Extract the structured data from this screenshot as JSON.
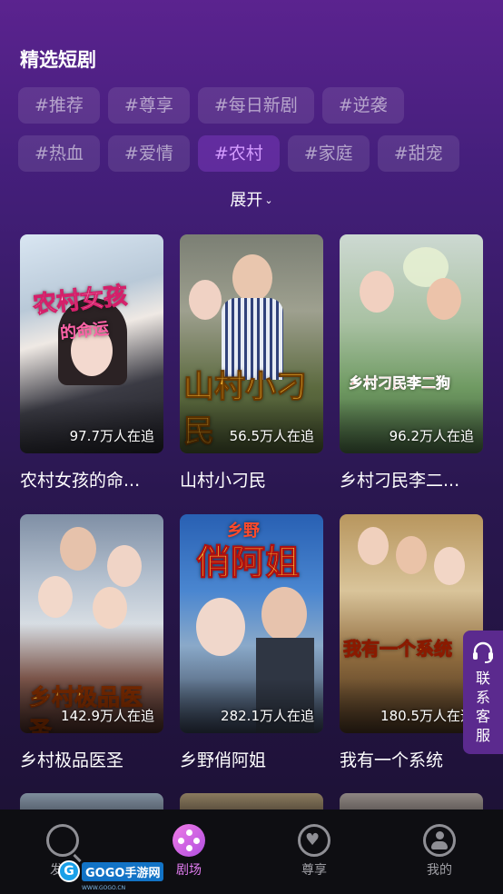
{
  "section_title": "精选短剧",
  "tags": [
    [
      "#推荐",
      "#尊享",
      "#每日新剧",
      "#逆袭"
    ],
    [
      "#热血",
      "#爱情",
      "#农村",
      "#家庭",
      "#甜宠"
    ]
  ],
  "active_tag": "#农村",
  "expand_label": "展开",
  "dramas": [
    {
      "title": "农村女孩的命...",
      "followers": "97.7万人在追",
      "poster_text": "农村女孩的命运"
    },
    {
      "title": "山村小刁民",
      "followers": "56.5万人在追",
      "poster_text": "山村小刁民"
    },
    {
      "title": "乡村刁民李二...",
      "followers": "96.2万人在追",
      "poster_text": "乡村刁民李二狗"
    },
    {
      "title": "乡村极品医圣",
      "followers": "142.9万人在追",
      "poster_text": "乡村极品医圣"
    },
    {
      "title": "乡野俏阿姐",
      "followers": "282.1万人在追",
      "poster_text": "乡野俏阿姐"
    },
    {
      "title": "我有一个系统",
      "followers": "180.5万人在追",
      "poster_text": "我有一个系统"
    }
  ],
  "side_tab": {
    "label": "联系客服",
    "icon": "headset-icon"
  },
  "tabbar": [
    {
      "label": "发现",
      "icon": "search-icon"
    },
    {
      "label": "剧场",
      "icon": "film-reel-icon",
      "active": true
    },
    {
      "label": "尊享",
      "icon": "heart-icon"
    },
    {
      "label": "我的",
      "icon": "user-icon"
    }
  ],
  "watermark": {
    "text": "GOGO手游网",
    "sub": "WWW.GOGO.CN"
  },
  "colors": {
    "accent": "#e27cf0",
    "background_top": "#5b238f",
    "tabbar": "#0e0e12"
  }
}
